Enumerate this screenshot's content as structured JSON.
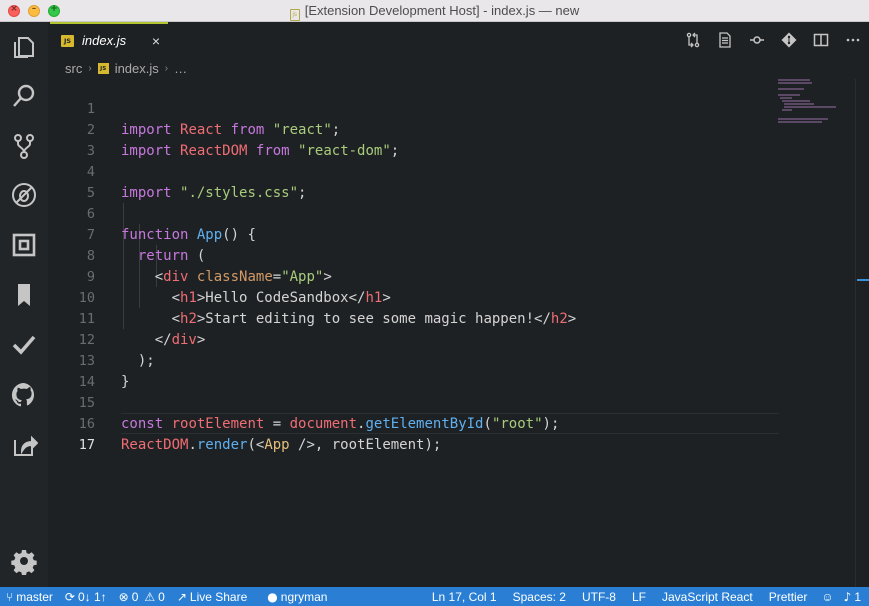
{
  "window": {
    "title": "[Extension Development Host] - index.js — new"
  },
  "activity_bar": {
    "items": [
      "explorer-icon",
      "search-icon",
      "source-control-icon",
      "debug-icon",
      "extensions-icon",
      "bookmark-icon",
      "tasks-icon",
      "github-icon",
      "live-share-icon"
    ],
    "bottom": "settings-gear-icon"
  },
  "tab": {
    "badge": "JS",
    "label": "index.js",
    "close": "×"
  },
  "editor_actions": [
    "open-changes-icon",
    "open-preview-icon",
    "go-back-icon",
    "git-lens-icon",
    "split-editor-icon",
    "more-actions-icon"
  ],
  "breadcrumb": {
    "folder": "src",
    "file": "index.js",
    "more": "…"
  },
  "editor": {
    "active_line": 17,
    "line_numbers": [
      "1",
      "2",
      "3",
      "4",
      "5",
      "6",
      "7",
      "8",
      "9",
      "10",
      "11",
      "12",
      "13",
      "14",
      "15",
      "16",
      "17"
    ]
  },
  "code": {
    "l1": {
      "t1": "import",
      "t2": " ",
      "t3": "React",
      "t4": " ",
      "t5": "from",
      "t6": " ",
      "t7": "\"react\"",
      "t8": ";"
    },
    "l2": {
      "t1": "import",
      "t2": " ",
      "t3": "ReactDOM",
      "t4": " ",
      "t5": "from",
      "t6": " ",
      "t7": "\"react-dom\"",
      "t8": ";"
    },
    "l4": {
      "t1": "import",
      "t2": " ",
      "t3": "\"./styles.css\"",
      "t4": ";"
    },
    "l6": {
      "t1": "function",
      "t2": " ",
      "t3": "App",
      "t4": "() {"
    },
    "l7": {
      "t1": "  ",
      "t2": "return",
      "t3": " ("
    },
    "l8": {
      "t1": "    <",
      "t2": "div",
      "t3": " ",
      "t4": "className",
      "t5": "=",
      "t6": "\"App\"",
      "t7": ">"
    },
    "l9": {
      "t1": "      <",
      "t2": "h1",
      "t3": ">Hello CodeSandbox</",
      "t4": "h1",
      "t5": ">"
    },
    "l10": {
      "t1": "      <",
      "t2": "h2",
      "t3": ">Start editing to see some magic happen!</",
      "t4": "h2",
      "t5": ">"
    },
    "l11": {
      "t1": "    </",
      "t2": "div",
      "t3": ">"
    },
    "l12": {
      "t1": "  );"
    },
    "l13": {
      "t1": "}"
    },
    "l15": {
      "t1": "const",
      "t2": " ",
      "t3": "rootElement",
      "t4": " = ",
      "t5": "document",
      "t6": ".",
      "t7": "getElementById",
      "t8": "(",
      "t9": "\"root\"",
      "t10": ");"
    },
    "l16": {
      "t1": "ReactDOM",
      "t2": ".",
      "t3": "render",
      "t4": "(<",
      "t5": "App",
      "t6": " />, rootElement);"
    }
  },
  "status_bar": {
    "branch": "master",
    "sync": "0↓ 1↑",
    "errors": "0",
    "warnings": "0",
    "live_share": "Live Share",
    "github_user": "ngryman",
    "position": "Ln 17, Col 1",
    "spaces": "Spaces: 2",
    "encoding": "UTF-8",
    "eol": "LF",
    "language": "JavaScript React",
    "formatter": "Prettier",
    "notifications": "1"
  },
  "colors": {
    "accent_tab": "#b2c531",
    "status_bar": "#2a7fd4",
    "keyword": "#c678dd",
    "string": "#a8cc7c",
    "function": "#60b0ef"
  }
}
